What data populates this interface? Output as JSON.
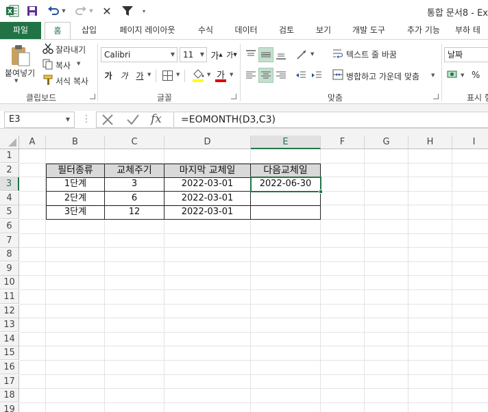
{
  "window": {
    "title": "통합 문서8 - Ex"
  },
  "tabs": {
    "file": "파일",
    "home": "홈",
    "insert": "삽입",
    "page_layout": "페이지 레이아웃",
    "formulas": "수식",
    "data": "데이터",
    "review": "검토",
    "view": "보기",
    "developer": "개발 도구",
    "addins": "추가 기능",
    "team": "부하 테"
  },
  "clipboard": {
    "paste": "붙여넣기",
    "cut": "잘라내기",
    "copy": "복사",
    "format_painter": "서식 복사",
    "label": "클립보드"
  },
  "font": {
    "name": "Calibri",
    "size": "11",
    "grow": "가",
    "shrink": "가",
    "bold": "가",
    "italic": "가",
    "underline": "가",
    "font_color": "가",
    "label": "글꼴",
    "font_color_hex": "#e00000",
    "fill_color_hex": "#ffff00"
  },
  "alignment": {
    "wrap_text": "텍스트 줄 바꿈",
    "merge_center": "병합하고 가운데 맞춤",
    "label": "맞춤"
  },
  "number": {
    "format": "날짜",
    "percent": "%",
    "label": "표시 형"
  },
  "formula_bar": {
    "name_box": "E3",
    "formula": "=EOMONTH(D3,C3)",
    "fx": "fx"
  },
  "sheet": {
    "columns": [
      "A",
      "B",
      "C",
      "D",
      "E",
      "F",
      "G",
      "H",
      "I"
    ],
    "rows": [
      "1",
      "2",
      "3",
      "4",
      "5",
      "6",
      "7",
      "8",
      "9",
      "10",
      "11",
      "12",
      "13",
      "14",
      "15",
      "16",
      "17",
      "18",
      "19"
    ],
    "selected_column": "E",
    "selected_row": "3",
    "table": {
      "headers": [
        "필터종류",
        "교체주기",
        "마지막 교체일",
        "다음교체일"
      ],
      "rows": [
        [
          "1단계",
          "3",
          "2022-03-01",
          "2022-06-30"
        ],
        [
          "2단계",
          "6",
          "2022-03-01",
          ""
        ],
        [
          "3단계",
          "12",
          "2022-03-01",
          ""
        ]
      ]
    }
  },
  "colors": {
    "accent": "#217346",
    "header_fill": "#d9d9d9"
  }
}
